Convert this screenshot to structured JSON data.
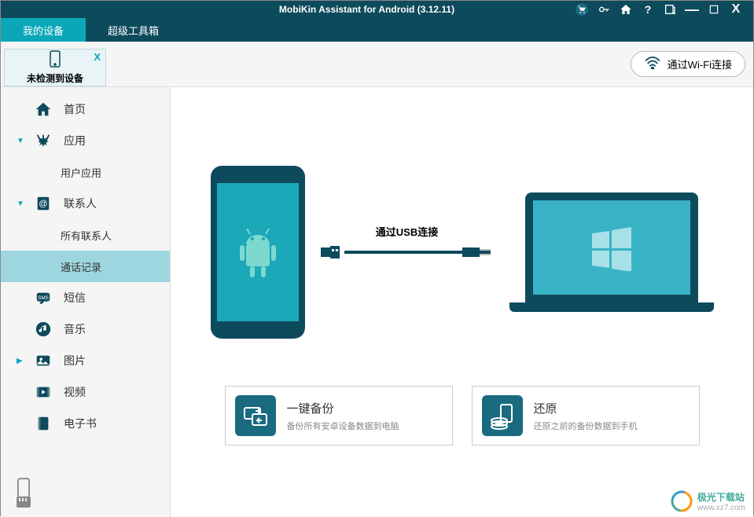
{
  "titlebar": {
    "title": "MobiKin Assistant for Android (3.12.11)"
  },
  "tabs": {
    "my_device": "我的设备",
    "super_toolkit": "超级工具箱"
  },
  "device_tab": {
    "label": "未检测到设备"
  },
  "wifi_button": "通过Wi-Fi连接",
  "sidebar": {
    "home": "首页",
    "apps": "应用",
    "user_apps": "用户应用",
    "contacts": "联系人",
    "all_contacts": "所有联系人",
    "call_logs": "通话记录",
    "sms": "短信",
    "music": "音乐",
    "photos": "图片",
    "videos": "视频",
    "ebooks": "电子书"
  },
  "usb_label": "通过USB连接",
  "cards": {
    "backup": {
      "title": "一键备份",
      "desc": "备份所有安卓设备数据到电脑"
    },
    "restore": {
      "title": "还原",
      "desc": "还原之前的备份数据到手机"
    }
  },
  "watermark": {
    "name": "极光下载站",
    "url": "www.xz7.com"
  }
}
